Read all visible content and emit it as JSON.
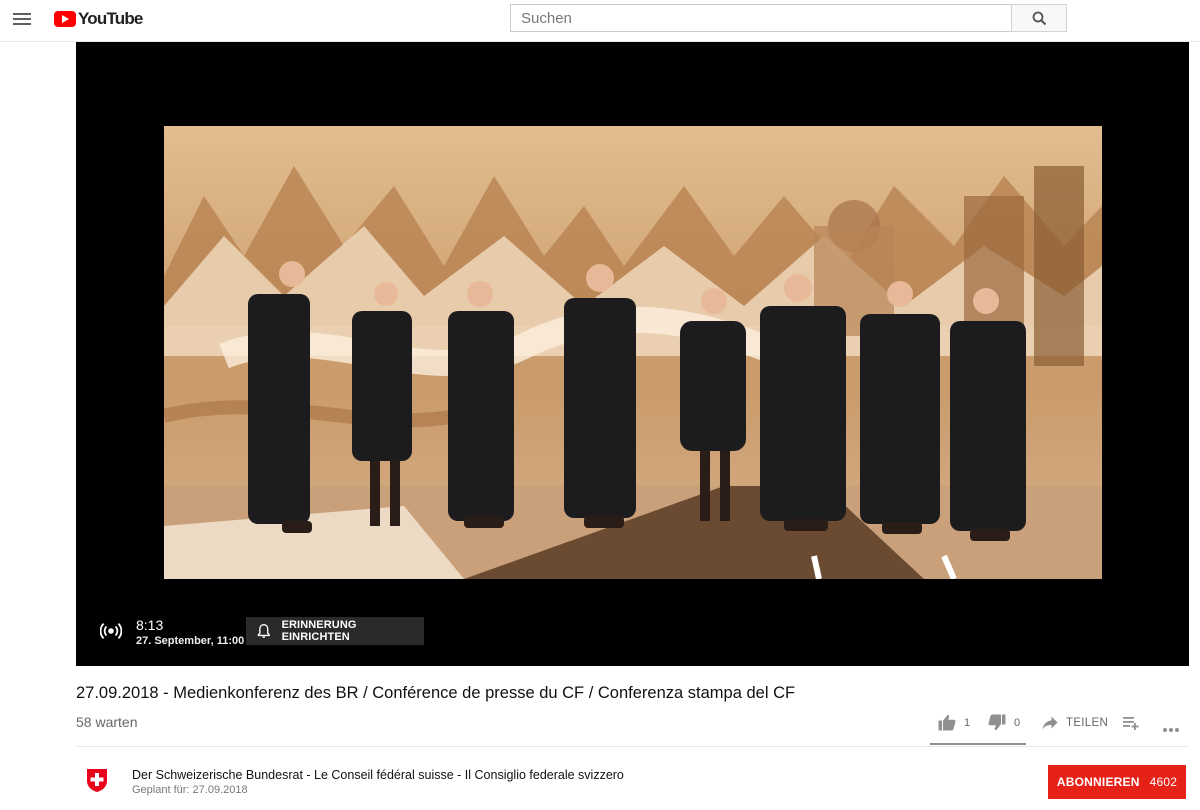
{
  "masthead": {
    "logo_text": "YouTube",
    "search_placeholder": "Suchen"
  },
  "player": {
    "countdown_time": "8:13",
    "countdown_date": "27. September, 11:00",
    "reminder_label": "ERINNERUNG EINRICHTEN"
  },
  "video": {
    "title": "27.09.2018 - Medienkonferenz des BR / Conférence de presse du CF / Conferenza stampa del CF",
    "waiting": "58 warten",
    "likes": "1",
    "dislikes": "0",
    "share_label": "TEILEN"
  },
  "channel": {
    "name": "Der Schweizerische Bundesrat - Le Conseil fédéral suisse - Il Consiglio federale svizzero",
    "scheduled": "Geplant für: 27.09.2018",
    "subscribe_label": "ABONNIEREN",
    "subscriber_count": "4602"
  },
  "colors": {
    "brand_red": "#ff0000",
    "subscribe_red": "#e62117",
    "thumbnail_bg": "#d9b48c"
  },
  "icons": [
    "menu-icon",
    "youtube-logo-icon",
    "search-icon",
    "live-broadcast-icon",
    "bell-icon",
    "thumbs-up-icon",
    "thumbs-down-icon",
    "share-arrow-icon",
    "add-to-playlist-icon",
    "more-dots-icon",
    "swiss-cross-icon"
  ]
}
